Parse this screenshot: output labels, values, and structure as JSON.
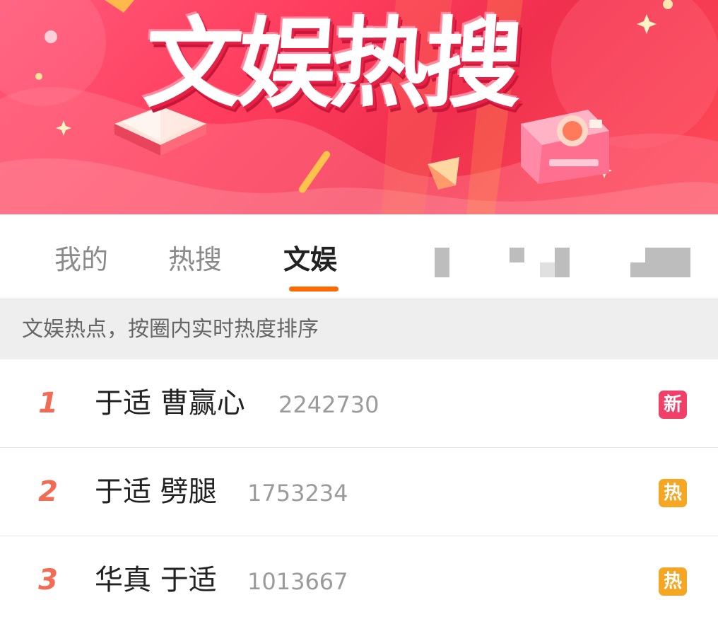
{
  "banner": {
    "title": "文娱热搜"
  },
  "tabs": {
    "items": [
      {
        "label": "我的",
        "active": false
      },
      {
        "label": "热搜",
        "active": false
      },
      {
        "label": "文娱",
        "active": true
      }
    ],
    "active_underline_color": "#ff6a00"
  },
  "subheader": {
    "text": "文娱热点，按圈内实时热度排序"
  },
  "hot_list": [
    {
      "rank": "1",
      "topic": "于适 曹赢心",
      "count": "2242730",
      "badge": "新",
      "badge_color": "#f0406a",
      "rank_color": "#f26b55"
    },
    {
      "rank": "2",
      "topic": "于适 劈腿",
      "count": "1753234",
      "badge": "热",
      "badge_color": "#f5a623",
      "rank_color": "#f26b55"
    },
    {
      "rank": "3",
      "topic": "华真 于适",
      "count": "1013667",
      "badge": "热",
      "badge_color": "#f5a623",
      "rank_color": "#f26b55"
    }
  ],
  "icons": [
    "book-icon",
    "camera-icon"
  ]
}
